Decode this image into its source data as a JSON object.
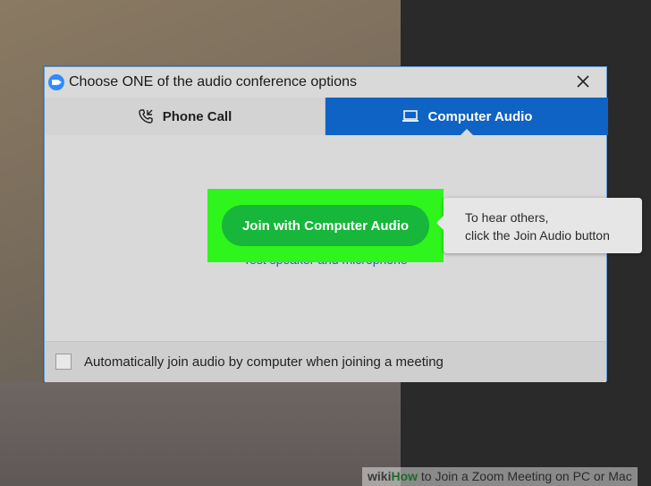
{
  "dialog": {
    "title": "Choose ONE of the audio conference options",
    "close_icon": "close-icon",
    "app_icon": "zoom-camera-icon"
  },
  "tabs": [
    {
      "label": "Phone Call",
      "icon": "phone-callback-icon",
      "selected": false
    },
    {
      "label": "Computer Audio",
      "icon": "laptop-icon",
      "selected": true
    }
  ],
  "content": {
    "join_button_label": "Join with Computer Audio",
    "test_link": "Test speaker and microphone",
    "tooltip": {
      "line1": "To hear others,",
      "line2": "click the Join Audio button"
    }
  },
  "footer": {
    "checkbox_label": "Automatically join audio by computer when joining a meeting",
    "checked": false
  },
  "watermark": {
    "logo": "wiki",
    "how": "How",
    "rest": " to Join a Zoom Meeting on PC or Mac"
  },
  "colors": {
    "tab_selected": "#0e63c4",
    "join_button": "#16b73a",
    "highlight": "#2ef51c",
    "link": "#2457c8"
  }
}
